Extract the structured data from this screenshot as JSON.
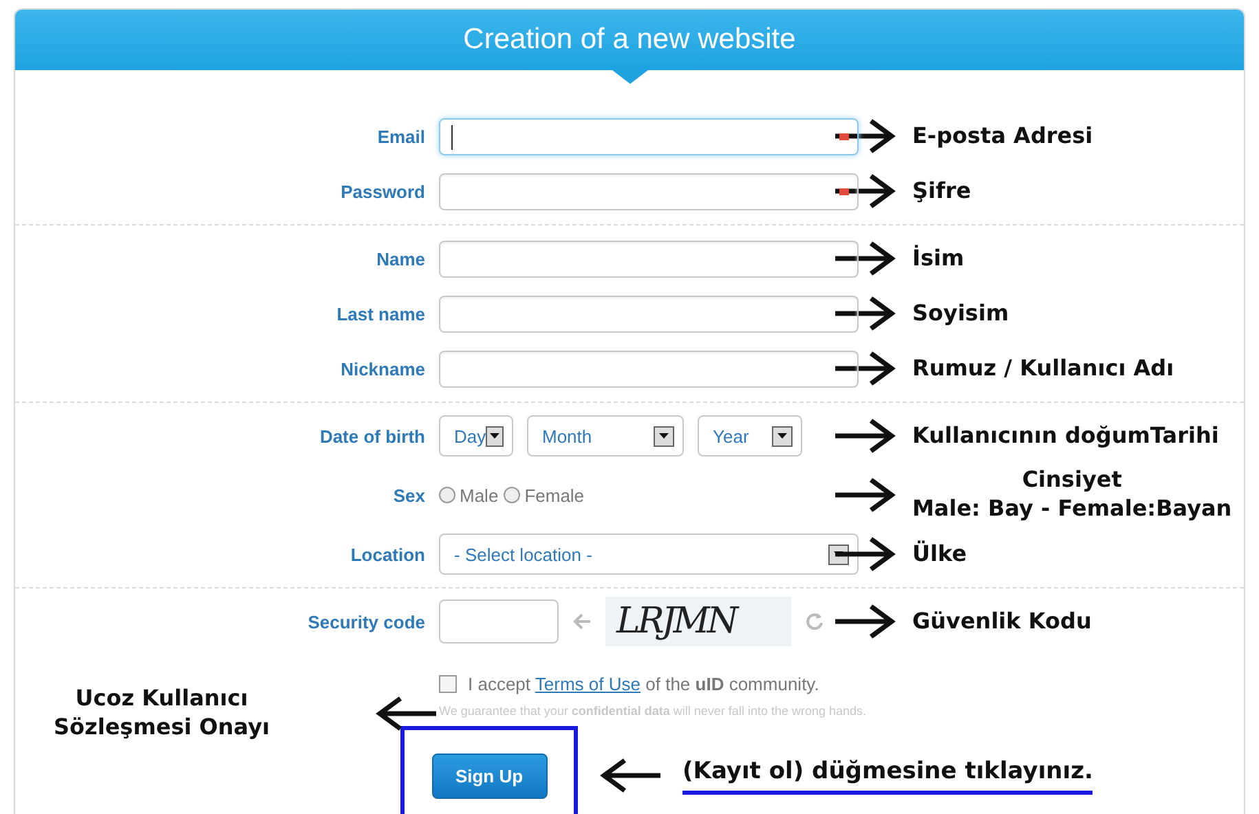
{
  "header": {
    "title": "Creation of a new website"
  },
  "sections": [
    {
      "rows": [
        {
          "kind": "text",
          "label": "Email",
          "focused": true,
          "required": true,
          "annotation": [
            "E-posta Adresi"
          ]
        },
        {
          "kind": "text",
          "label": "Password",
          "focused": false,
          "required": true,
          "annotation": [
            "Şifre"
          ]
        }
      ]
    },
    {
      "rows": [
        {
          "kind": "text",
          "label": "Name",
          "focused": false,
          "required": false,
          "annotation": [
            "İsim"
          ]
        },
        {
          "kind": "text",
          "label": "Last name",
          "focused": false,
          "required": false,
          "annotation": [
            "Soyisim"
          ]
        },
        {
          "kind": "text",
          "label": "Nickname",
          "focused": false,
          "required": false,
          "annotation": [
            "Rumuz / Kullanıcı Adı"
          ]
        }
      ]
    },
    {
      "rows": [
        {
          "kind": "date",
          "label": "Date of birth",
          "selects": [
            "Day",
            "Month",
            "Year"
          ],
          "annotation": [
            "Kullanıcının doğumTarihi"
          ]
        },
        {
          "kind": "radio",
          "label": "Sex",
          "options": [
            {
              "label": "Male",
              "selected": false
            },
            {
              "label": "Female",
              "selected": false
            }
          ],
          "annotation": [
            "Cinsiyet",
            "Male: Bay - Female:Bayan"
          ]
        },
        {
          "kind": "select",
          "label": "Location",
          "value": "- Select location -",
          "annotation": [
            "Ülke"
          ]
        }
      ]
    },
    {
      "rows": [
        {
          "kind": "captcha",
          "label": "Security code",
          "captcha": "LRJMN",
          "annotation": [
            "Güvenlik Kodu"
          ]
        }
      ]
    }
  ],
  "terms": {
    "checked": false,
    "text_before": "I accept",
    "link": "Terms of Use",
    "text_after": "of the **uID** community.",
    "note": "We guarantee that your **confidential data** will never fall into the wrong hands.",
    "annotation": [
      "Ucoz Kullanıcı",
      "Sözleşmesi Onayı"
    ]
  },
  "submit": {
    "label": "Sign Up",
    "annotation": "(Kayıt ol) düğmesine tıklayınız."
  }
}
